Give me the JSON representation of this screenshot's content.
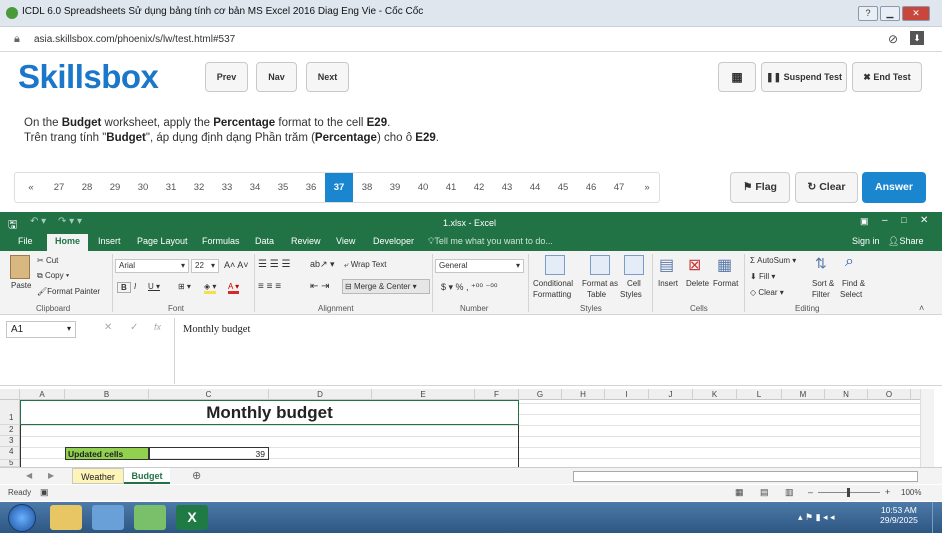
{
  "browser": {
    "title": "ICDL 6.0 Spreadsheets Sử dụng bảng tính cơ bản MS Excel 2016 Diag Eng Vie - Cốc Cốc",
    "url": "asia.skillsbox.com/phoenix/s/lw/test.html#537"
  },
  "header": {
    "logo": "Skillsbox",
    "prev": "Prev",
    "nav": "Nav",
    "next": "Next",
    "suspend": "Suspend Test",
    "end": "End Test"
  },
  "question": {
    "en": [
      "On the ",
      "Budget",
      " worksheet, apply the ",
      "Percentage",
      " format to the cell ",
      "E29",
      "."
    ],
    "vi": [
      "Trên trang tính \"",
      "Budget",
      "\", áp dụng định dạng Phần trăm (",
      "Percentage",
      ") cho ô ",
      "E29",
      "."
    ]
  },
  "pager": {
    "first": "«",
    "last": "»",
    "pages": [
      "27",
      "28",
      "29",
      "30",
      "31",
      "32",
      "33",
      "34",
      "35",
      "36",
      "37",
      "38",
      "39",
      "40",
      "41",
      "42",
      "43",
      "44",
      "45",
      "46",
      "47"
    ],
    "current": "37"
  },
  "actions": {
    "flag": "Flag",
    "clear": "Clear",
    "answer": "Answer"
  },
  "excel": {
    "title": "1.xlsx - Excel",
    "tabs": [
      "File",
      "Home",
      "Insert",
      "Page Layout",
      "Formulas",
      "Data",
      "Review",
      "View",
      "Developer"
    ],
    "tell_me": "Tell me what you want to do...",
    "sign_in": "Sign in",
    "share": "Share",
    "ribbon": {
      "paste": "Paste",
      "cut": "Cut",
      "copy": "Copy",
      "format_painter": "Format Painter",
      "clipboard": "Clipboard",
      "font_name": "Arial",
      "font_size": "22",
      "font": "Font",
      "wrap": "Wrap Text",
      "merge": "Merge & Center",
      "alignment": "Alignment",
      "numfmt": "General",
      "number": "Number",
      "cond1": "Conditional",
      "cond2": "Formatting",
      "fat1": "Format as",
      "fat2": "Table",
      "cs1": "Cell",
      "cs2": "Styles",
      "styles": "Styles",
      "insert": "Insert",
      "delete": "Delete",
      "format": "Format",
      "cells": "Cells",
      "autosum": "AutoSum",
      "fill": "Fill",
      "clear": "Clear",
      "sort1": "Sort &",
      "sort2": "Filter",
      "find1": "Find &",
      "find2": "Select",
      "editing": "Editing"
    },
    "name_box": "A1",
    "fx": "fx",
    "formula": "Monthly budget",
    "columns": [
      "A",
      "B",
      "C",
      "D",
      "E",
      "F",
      "G",
      "H",
      "I",
      "J",
      "K",
      "L",
      "M",
      "N",
      "O"
    ],
    "rows": [
      "1",
      "2",
      "3",
      "4",
      "5"
    ],
    "cells": {
      "c1": "Monthly budget",
      "b4": "Updated cells",
      "c4": "39"
    },
    "sheets": [
      "Weather",
      "Budget"
    ],
    "status": {
      "ready": "Ready",
      "zoom": "100%"
    }
  },
  "taskbar": {
    "time": "10:53 AM",
    "date": "29/9/2025"
  }
}
